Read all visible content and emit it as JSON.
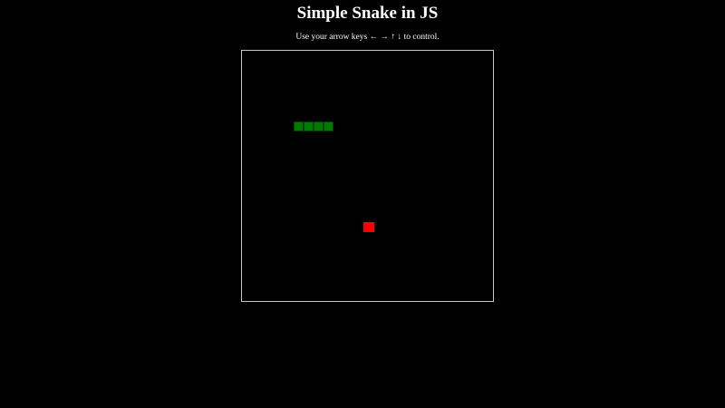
{
  "header": {
    "title": "Simple Snake in JS",
    "instructions": "Use your arrow keys ← → ↑ ↓ to control."
  },
  "game": {
    "grid_size": 25,
    "snake": [
      {
        "col": 5,
        "row": 7
      },
      {
        "col": 6,
        "row": 7
      },
      {
        "col": 7,
        "row": 7
      },
      {
        "col": 8,
        "row": 7
      }
    ],
    "food": {
      "col": 12,
      "row": 17
    },
    "colors": {
      "background": "#000000",
      "board_border": "#c8c8c8",
      "snake": "#007a00",
      "snake_outline": "#003d00",
      "food": "#ff0000",
      "text": "#ffffff"
    }
  }
}
